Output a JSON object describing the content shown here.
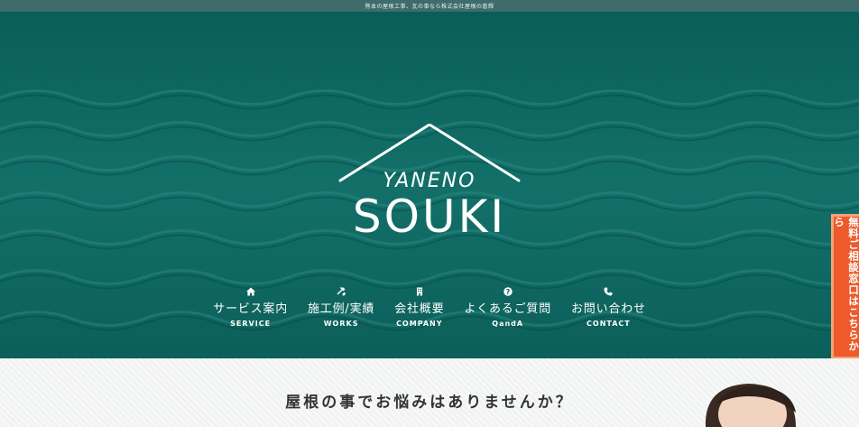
{
  "topbar": {
    "text": "熊本の屋根工事、瓦の事なら株式会社屋根の蒼輝"
  },
  "logo": {
    "line1": "YANENO",
    "line2": "SOUKI"
  },
  "nav": [
    {
      "icon": "home-icon",
      "label": "サービス案内",
      "sub": "SERVICE"
    },
    {
      "icon": "hammer-icon",
      "label": "施工例/実績",
      "sub": "WORKS"
    },
    {
      "icon": "building-icon",
      "label": "会社概要",
      "sub": "COMPANY"
    },
    {
      "icon": "question-icon",
      "label": "よくあるご質問",
      "sub": "QandA"
    },
    {
      "icon": "phone-icon",
      "label": "お問い合わせ",
      "sub": "CONTACT"
    }
  ],
  "side_tab": {
    "label": "無料ご相談窓口はこちらから"
  },
  "section": {
    "title": "屋根の事でお悩みはありませんか？"
  },
  "colors": {
    "hero": "#0d625d",
    "topbar": "#3f6b6a",
    "accent": "#ee5a2a"
  }
}
